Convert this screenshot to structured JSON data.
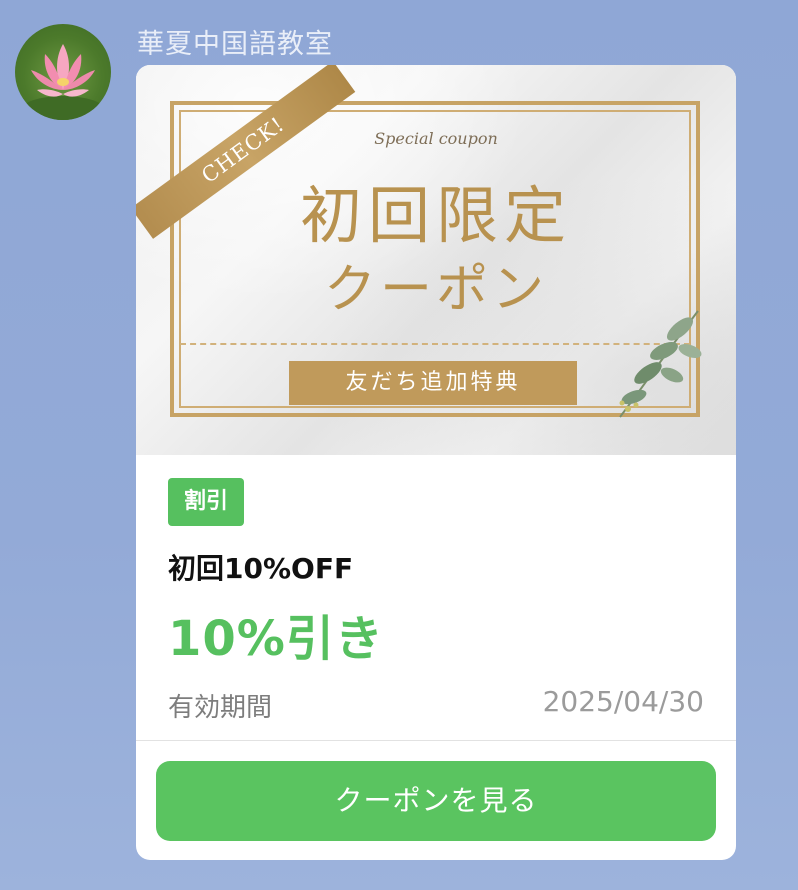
{
  "chat": {
    "sender_name": "華夏中国語教室",
    "avatar_icon": "lotus-flower-icon"
  },
  "banner": {
    "ribbon_text": "CHECK!",
    "script_text": "Special coupon",
    "headline_line1": "初回限定",
    "headline_line2": "クーポン",
    "band_text": "友だち追加特典",
    "accent_color": "#c09a5b"
  },
  "coupon": {
    "badge": "割引",
    "title": "初回10%OFF",
    "value": "10%引き",
    "validity_label": "有効期間",
    "validity_date": "2025/04/30",
    "button_label": "クーポンを見る",
    "accent_color": "#56c05f"
  }
}
